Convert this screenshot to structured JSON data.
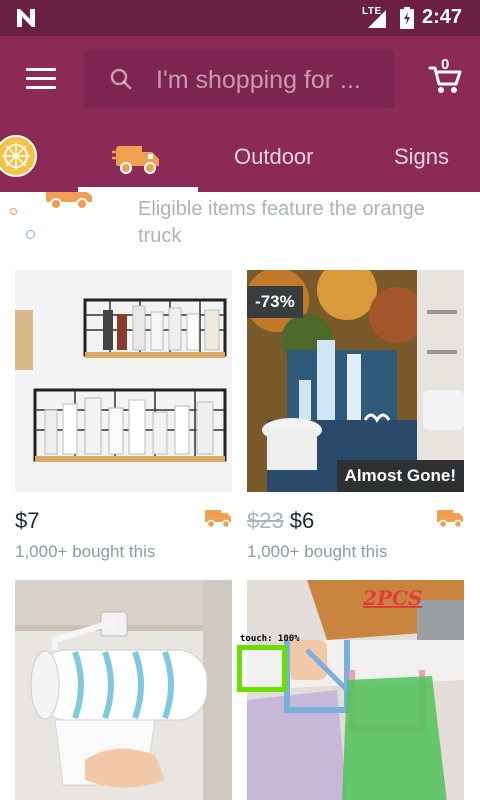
{
  "status_bar": {
    "network": "LTE",
    "time": "2:47"
  },
  "header": {
    "search_placeholder": "I'm shopping for ...",
    "cart_count": "0"
  },
  "tabs": [
    {
      "label": "",
      "icon": "sun-icon"
    },
    {
      "label": "",
      "icon": "truck-icon",
      "selected": true
    },
    {
      "label": "Outdoor"
    },
    {
      "label": "Signs"
    }
  ],
  "banner": {
    "text": "Eligible items feature the orange truck"
  },
  "products": [
    {
      "price": "$7",
      "old_price": "",
      "bought": "1,000+ bought this",
      "discount": "",
      "badge": ""
    },
    {
      "price": "$6",
      "old_price": "$23",
      "bought": "1,000+ bought this",
      "discount": "-73%",
      "badge": "Almost Gone!"
    },
    {
      "price": "",
      "old_price": "",
      "bought": "",
      "discount": "",
      "badge": "",
      "image_text": "2PCS"
    },
    {
      "price": "",
      "old_price": "",
      "bought": "",
      "discount": "",
      "badge": ""
    }
  ],
  "overlay": {
    "touch_label": "touch: 100%"
  },
  "colors": {
    "status_bar": "#6b1f43",
    "brand": "#8b2a57",
    "truck_orange": "#f0a050",
    "touch_marker": "#6ae000"
  }
}
